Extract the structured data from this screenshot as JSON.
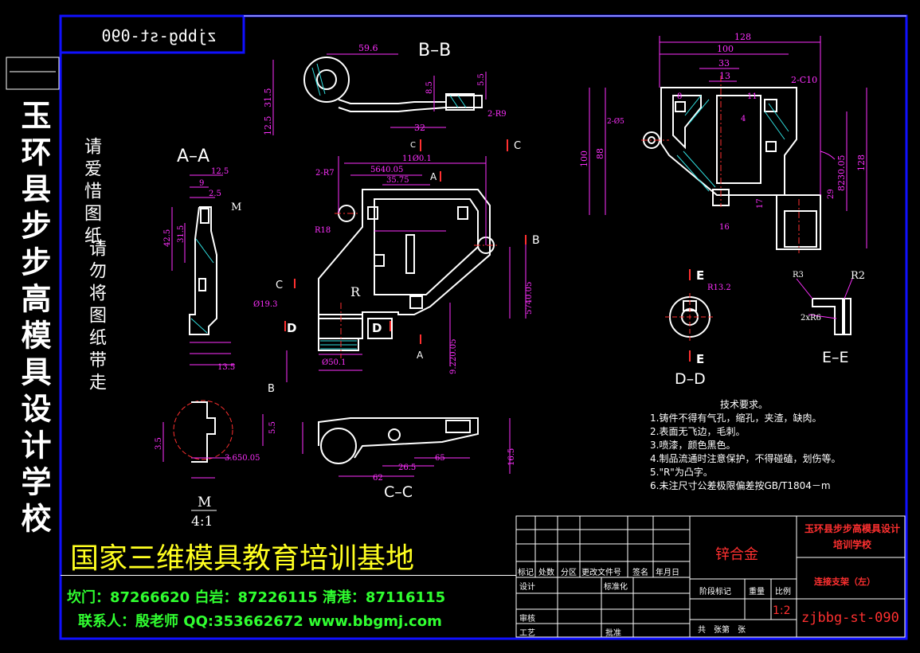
{
  "colors": {
    "background": "#000000",
    "frame": "#1010ff",
    "outline": "#ffffff",
    "dimension": "#ff30ff",
    "center_line": "#ff3030",
    "hatch": "#30e0e0",
    "leader": "#30e030",
    "school_text": "#ffffff",
    "banner_text": "#ffff20",
    "contact_text": "#30ff30",
    "title_red": "#ff3030"
  },
  "corner_code_mirrored": "zjbbg-st-090",
  "side_school": "玉环县步步高模具设计学校",
  "side_notice_col1": "请爱惜图纸",
  "side_notice_col2": "请勿将图纸带走",
  "views": {
    "aa": "A–A",
    "bb": "B–B",
    "cc": "C–C",
    "dd": "D–D",
    "ee": "E–E",
    "detail_m": "M",
    "detail_scale": "4:1",
    "marker_m": "M",
    "marker_r": "R"
  },
  "section_letters": {
    "a": "A",
    "b": "B",
    "c": "C",
    "d": "D",
    "e": "E"
  },
  "dims": {
    "d128": "128",
    "d100": "100",
    "d33": "33",
    "d13": "13",
    "dc10": "2-C10",
    "d8": "8",
    "d11": "11",
    "d4": "4",
    "d88": "88",
    "d100v": "100",
    "d128v": "128",
    "d8230": "8230.05",
    "d29": "29",
    "d17": "17",
    "d16": "16",
    "d2_5": "2-Ø5",
    "d596": "59.6",
    "d315": "31.5",
    "d125": "12.5",
    "d32": "32",
    "d85": "8.5",
    "d55": "5.5",
    "d2r9": "2-R9",
    "dr18": "R18",
    "dr2": "R2",
    "dr3": "R3",
    "d113": "11Ø0.1",
    "d5640": "5640.05",
    "d3575": "35.75",
    "d2r7": "2-R7",
    "d219": "Ø19.3",
    "d50": "Ø50.1",
    "d5740": "5740.05",
    "d9220": "9.220.05",
    "d125b": "12.5",
    "d425": "42.5",
    "d315b": "31.5",
    "d25": "2.5",
    "d9": "9",
    "d135": "13.5",
    "d35": "3.5",
    "d55b": "5.5",
    "d165": "16.5",
    "d65": "65",
    "d62": "62",
    "d265": "26.5",
    "dr13": "R13.2",
    "d2r6": "2xR6",
    "d3650": "3.650.05"
  },
  "tech_requirements": {
    "title": "技术要求。",
    "items": [
      "1.铸件不得有气孔，缩孔，夹渣，缺肉。",
      "2.表面无飞边，毛刺。",
      "3.喷漆，颜色黑色。",
      "4.制品流通时注意保护，不得碰磕，划伤等。",
      "5.\"R\"为凸字。",
      "6.未注尺寸公差极限偏差按GB/T1804－m"
    ]
  },
  "banner": "国家三维模具教育培训基地",
  "contact": {
    "line1": "坎门：87266620 白岩：87226115 清港：87116115",
    "line2": "联系人：殷老师 QQ:353662672 www.bbgmj.com"
  },
  "title_block": {
    "material": "锌合金",
    "school": "玉环县步步高模具设计培训学校",
    "part_name": "连接支架（左）",
    "drawing_no": "zjbbg-st-090",
    "scale": "1:2",
    "hdr_mark": "标记",
    "hdr_count": "处数",
    "hdr_zone": "分区",
    "hdr_docno": "更改文件号",
    "hdr_sign": "签名",
    "hdr_date": "年月日",
    "design": "设计",
    "standard": "标准化",
    "review": "审核",
    "process": "工艺",
    "approve": "批准",
    "stage_mark": "阶段标记",
    "weight": "重量",
    "ratio": "比例",
    "sheets": "共　张第　张"
  }
}
